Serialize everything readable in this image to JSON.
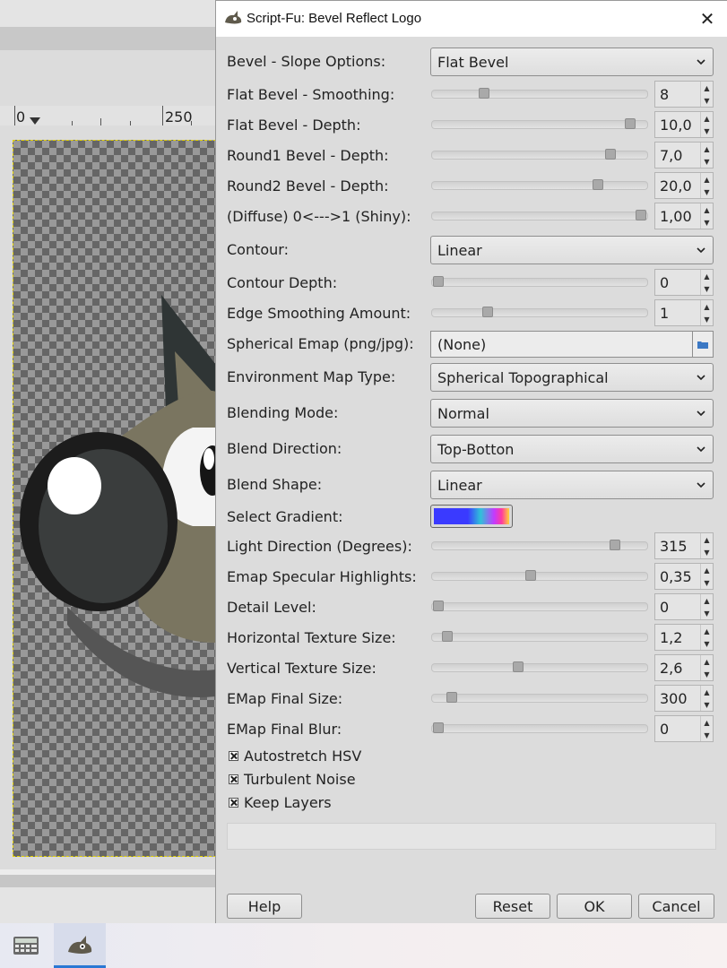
{
  "ruler": {
    "label_0": "0",
    "label_250": "250"
  },
  "dialog": {
    "title": "Script-Fu: Bevel Reflect Logo",
    "close_glyph": "✕",
    "bevel_slope": {
      "label": "Bevel - Slope Options:",
      "value": "Flat Bevel"
    },
    "flat_smoothing": {
      "label": "Flat Bevel - Smoothing:",
      "value": "8",
      "slider_fraction": 0.24
    },
    "flat_depth": {
      "label": "Flat Bevel - Depth:",
      "value": "10,0",
      "slider_fraction": 0.92
    },
    "round1_depth": {
      "label": "Round1 Bevel - Depth:",
      "value": "7,0",
      "slider_fraction": 0.83
    },
    "round2_depth": {
      "label": "Round2 Bevel - Depth:",
      "value": "20,0",
      "slider_fraction": 0.77
    },
    "diffuse_shiny": {
      "label": "(Diffuse) 0<--->1 (Shiny):",
      "value": "1,00",
      "slider_fraction": 0.97
    },
    "contour": {
      "label": "Contour:",
      "value": "Linear"
    },
    "contour_depth": {
      "label": "Contour Depth:",
      "value": "0",
      "slider_fraction": 0.03
    },
    "edge_smoothing": {
      "label": "Edge Smoothing Amount:",
      "value": "1",
      "slider_fraction": 0.26
    },
    "spherical_emap": {
      "label": "Spherical Emap (png/jpg):",
      "value": "(None)"
    },
    "env_map_type": {
      "label": "Environment Map Type:",
      "value": "Spherical Topographical"
    },
    "blending_mode": {
      "label": "Blending Mode:",
      "value": "Normal"
    },
    "blend_direction": {
      "label": "Blend Direction:",
      "value": "Top-Botton"
    },
    "blend_shape": {
      "label": "Blend Shape:",
      "value": "Linear"
    },
    "select_gradient": {
      "label": "Select Gradient:"
    },
    "light_direction": {
      "label": "Light Direction (Degrees):",
      "value": "315",
      "slider_fraction": 0.85
    },
    "emap_specular": {
      "label": "Emap Specular Highlights:",
      "value": "0,35",
      "slider_fraction": 0.46
    },
    "detail_level": {
      "label": "Detail Level:",
      "value": "0",
      "slider_fraction": 0.03
    },
    "h_texture": {
      "label": "Horizontal Texture Size:",
      "value": "1,2",
      "slider_fraction": 0.07
    },
    "v_texture": {
      "label": "Vertical Texture Size:",
      "value": "2,6",
      "slider_fraction": 0.4
    },
    "emap_final_size": {
      "label": "EMap Final Size:",
      "value": "300",
      "slider_fraction": 0.09
    },
    "emap_final_blur": {
      "label": "EMap Final Blur:",
      "value": "0",
      "slider_fraction": 0.03
    },
    "checkboxes": {
      "autostretch": "Autostretch HSV",
      "turbulent": "Turbulent Noise",
      "keep_layers": "Keep Layers"
    },
    "buttons": {
      "help": "Help",
      "reset": "Reset",
      "ok": "OK",
      "cancel": "Cancel"
    }
  },
  "icons": {
    "spin_up": "▲",
    "spin_down": "▼"
  },
  "colors": {
    "accent": "#2a78d4",
    "dialog_bg": "#dcdcdc",
    "title_bg": "#ffffff"
  }
}
